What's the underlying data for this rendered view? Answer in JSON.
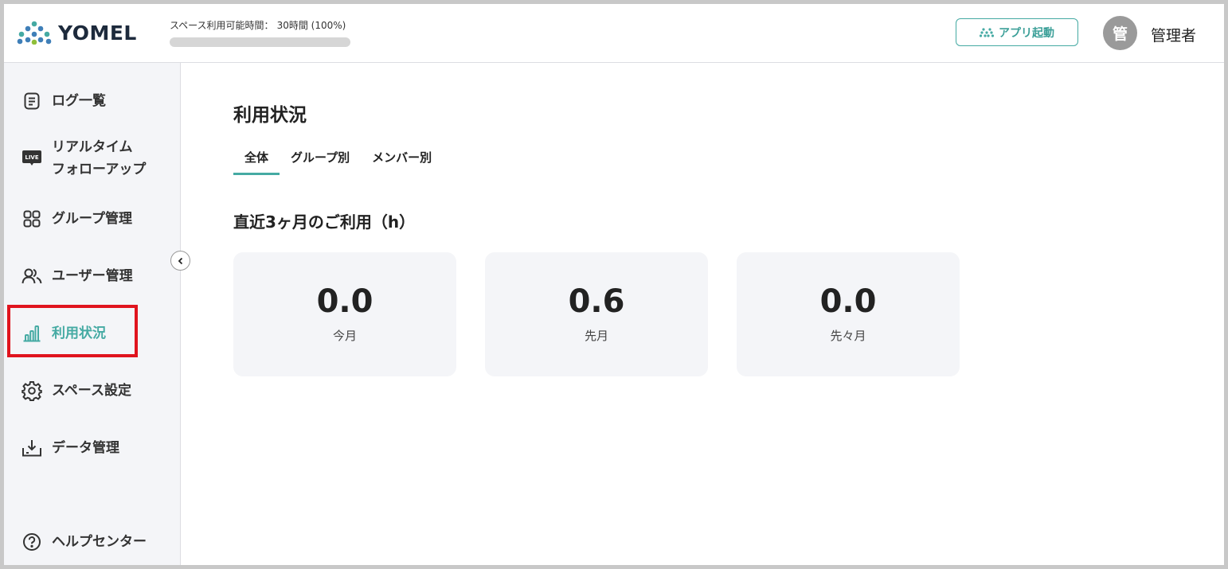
{
  "header": {
    "brand": "YOMEL",
    "space_usage_label": "スペース利用可能時間：",
    "space_usage_value": "30時間 (100%)",
    "space_usage_percent": 100,
    "app_button_label": "アプリ起動",
    "avatar_initial": "管",
    "user_name": "管理者"
  },
  "sidebar": {
    "items": [
      {
        "label": "ログ一覧",
        "icon": "document-list-icon"
      },
      {
        "label": "リアルタイム",
        "label2": "フォローアップ",
        "icon": "live-icon",
        "badge": "LIVE"
      },
      {
        "label": "グループ管理",
        "icon": "grid-icon"
      },
      {
        "label": "ユーザー管理",
        "icon": "users-icon"
      },
      {
        "label": "利用状況",
        "icon": "bar-chart-icon",
        "active": true
      },
      {
        "label": "スペース設定",
        "icon": "gear-icon"
      },
      {
        "label": "データ管理",
        "icon": "download-icon"
      },
      {
        "label": "ヘルプセンター",
        "icon": "help-icon"
      }
    ]
  },
  "main": {
    "title": "利用状況",
    "tabs": [
      {
        "label": "全体",
        "active": true
      },
      {
        "label": "グループ別"
      },
      {
        "label": "メンバー別"
      }
    ],
    "section_title": "直近3ヶ月のご利用（h）",
    "cards": [
      {
        "value": "0.0",
        "label": "今月"
      },
      {
        "value": "0.6",
        "label": "先月"
      },
      {
        "value": "0.0",
        "label": "先々月"
      }
    ]
  },
  "colors": {
    "accent": "#45aaa3",
    "highlight": "#e0141e",
    "sidebar_bg": "#f4f5f8"
  }
}
